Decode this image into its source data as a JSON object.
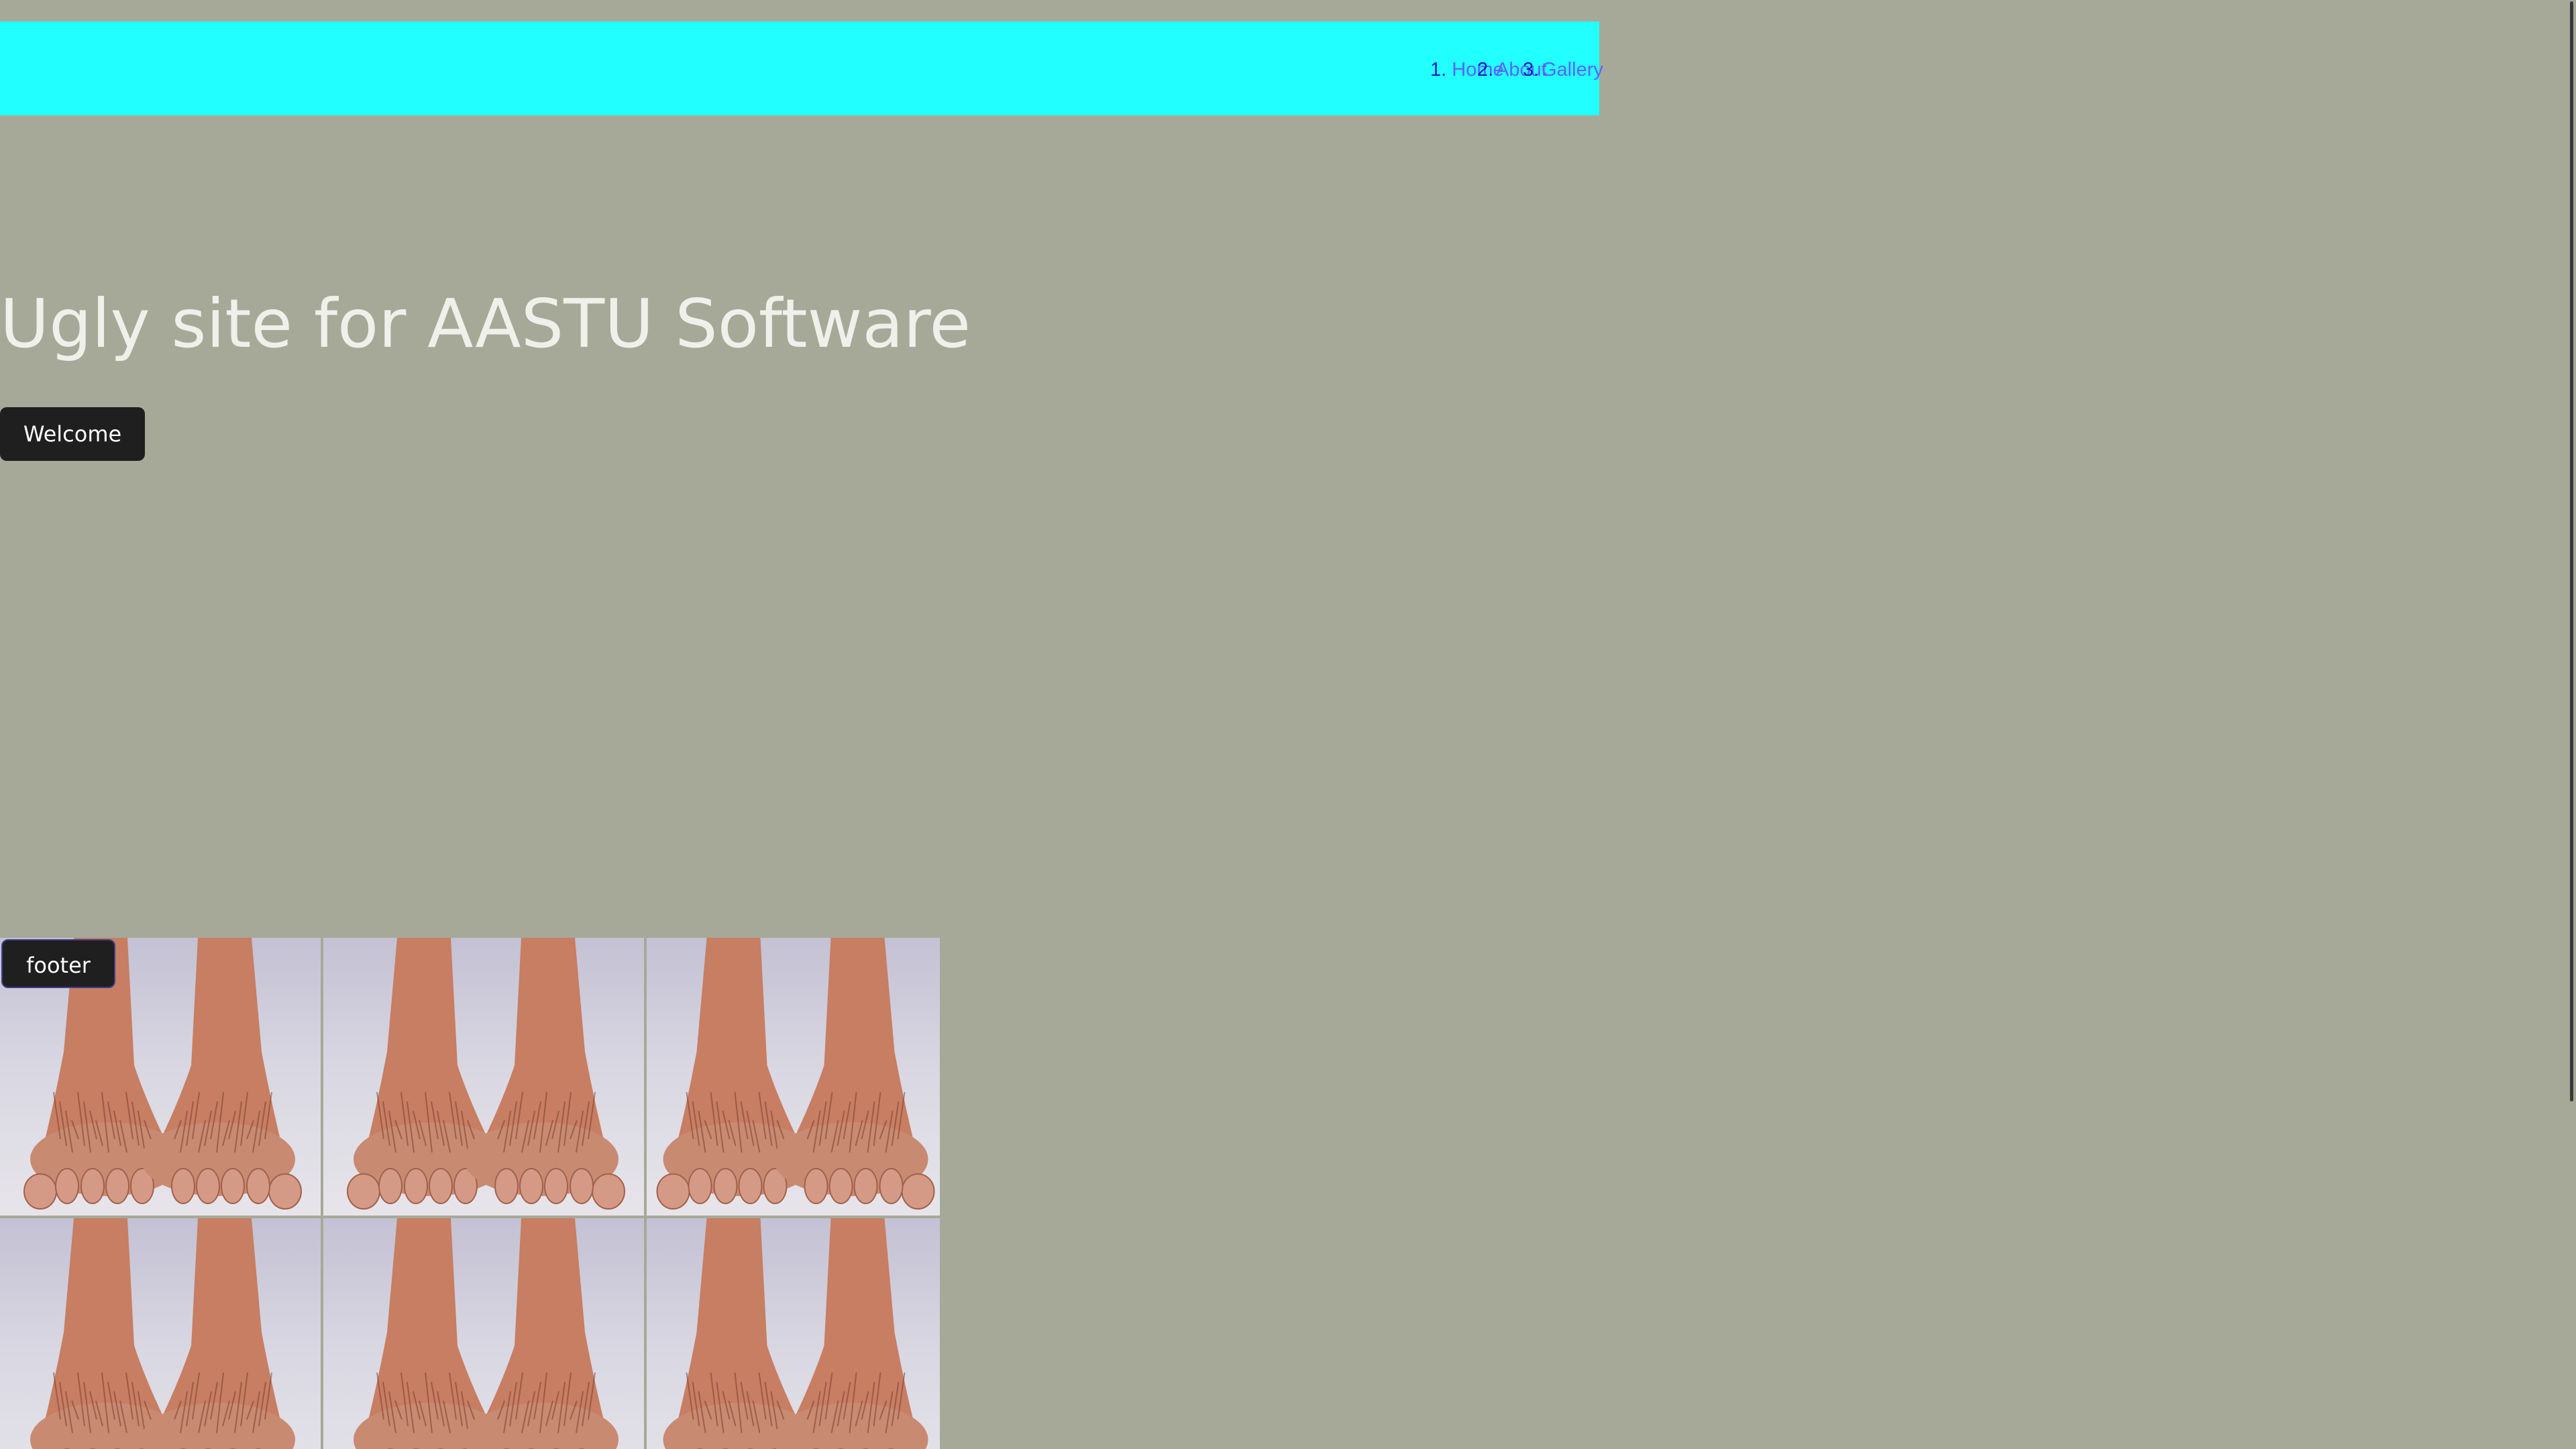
{
  "nav": {
    "items": [
      {
        "num": "1.",
        "label": "Home"
      },
      {
        "num": "2.",
        "label": "About"
      },
      {
        "num": "3.",
        "label": "Gallery"
      }
    ]
  },
  "hero": {
    "title": "Ugly site for AASTU Software",
    "welcome_label": "Welcome"
  },
  "footer": {
    "label": "footer"
  },
  "gallery": {
    "image_subject": "feet-photo",
    "count": 6
  },
  "colors": {
    "page_background": "#a6a998",
    "navbar_background": "#22ffff",
    "nav_number": "#1818c8",
    "nav_link": "#5a64ff",
    "title_text": "#f0f0eb",
    "button_background": "#1f1f1f",
    "button_text": "#ffffff"
  }
}
